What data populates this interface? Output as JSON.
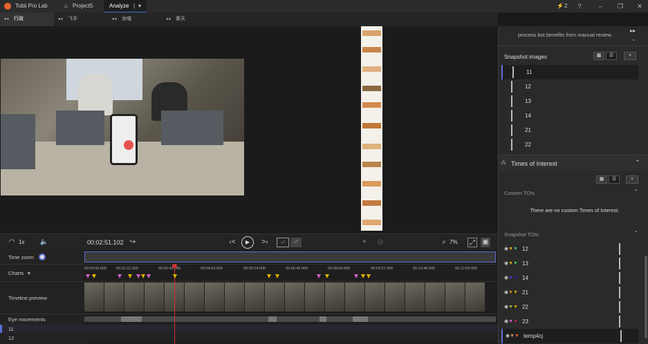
{
  "titlebar": {
    "app_name": "Tobii Pro Lab",
    "project_tab": "Project5",
    "analyze_tab": "Analyze",
    "notifications_count": "2"
  },
  "participant_tabs": [
    "行政",
    "飞手",
    "龙喵",
    "秦天"
  ],
  "toolbar": {
    "speed": "1x",
    "timecode": "00:02:51.102",
    "zoom_percent": "7%"
  },
  "timeline": {
    "labels": {
      "time_zoom": "Time zoom",
      "charts": "Charts",
      "timeline_preview": "Timeline preview",
      "eye_movements": "Eye movements",
      "row_11": "11",
      "row_12": "12"
    },
    "ruler_ticks": [
      "00:00:00.000",
      "00:01:21.000",
      "00:02:42.000",
      "00:04:03.000",
      "00:05:24.000",
      "00:06:45.000",
      "00:08:06.000",
      "00:09:27.000",
      "00:10:48.000",
      "00:12:09.000"
    ]
  },
  "right_panel": {
    "top_text": "process but benefits from manual review.",
    "snapshot_images_title": "Snapshot images",
    "snapshot_images": [
      "11",
      "12",
      "13",
      "14",
      "21",
      "22"
    ],
    "times_of_interest_title": "Times of Interest",
    "custom_tois_title": "Custom TOIs",
    "no_custom_tois": "There are no custom Times of Interest.",
    "snapshot_tois_title": "Snapshot TOIs",
    "snapshot_tois": [
      "12",
      "13",
      "14",
      "21",
      "22",
      "23",
      "temp4cj"
    ]
  },
  "colors": {
    "accent_blue": "#5a6fd6",
    "playhead_red": "#d93030",
    "marker_yellow": "#e0b400",
    "marker_pink": "#d35fc7",
    "marker_orange": "#e8642c"
  }
}
